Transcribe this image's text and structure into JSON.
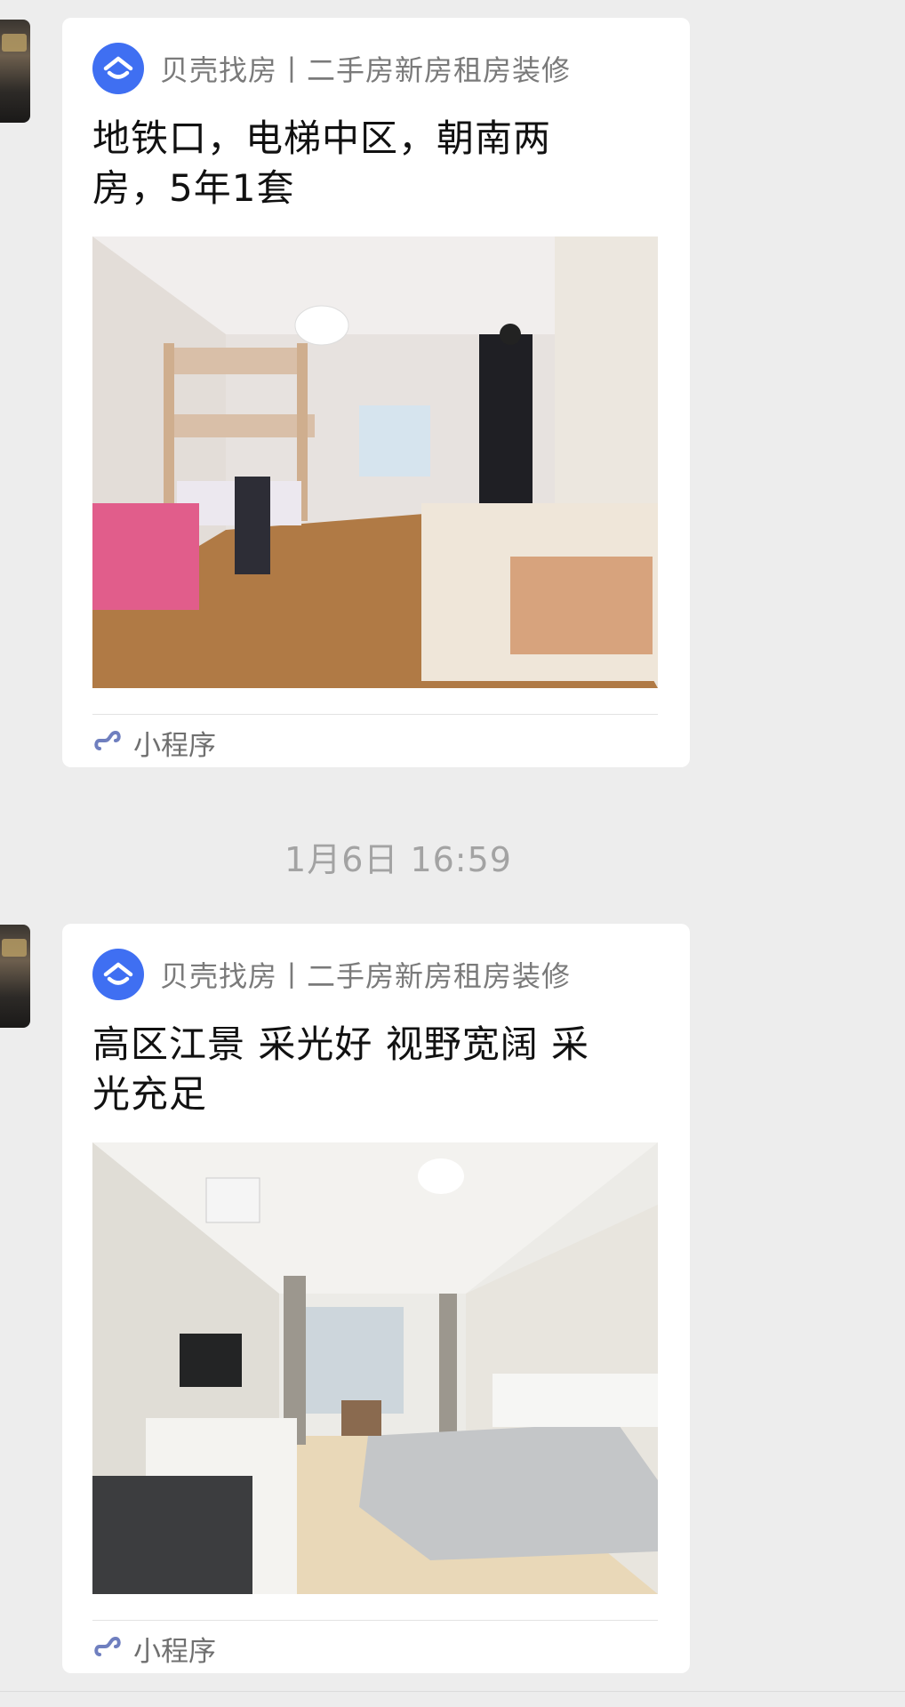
{
  "messages": [
    {
      "brand": "贝壳找房丨二手房新房租房装修",
      "title": "地铁口，电梯中区，朝南两房，5年1套",
      "footer": "小程序"
    },
    {
      "brand": "贝壳找房丨二手房新房租房装修",
      "title": "高区江景 采光好 视野宽阔 采光充足",
      "footer": "小程序"
    }
  ],
  "timestamp": "1月6日 16:59",
  "colors": {
    "brand_blue": "#3f6ff2",
    "background": "#ededed"
  },
  "icons": {
    "brand": "beike-logo-icon",
    "miniprogram": "miniprogram-link-icon"
  }
}
